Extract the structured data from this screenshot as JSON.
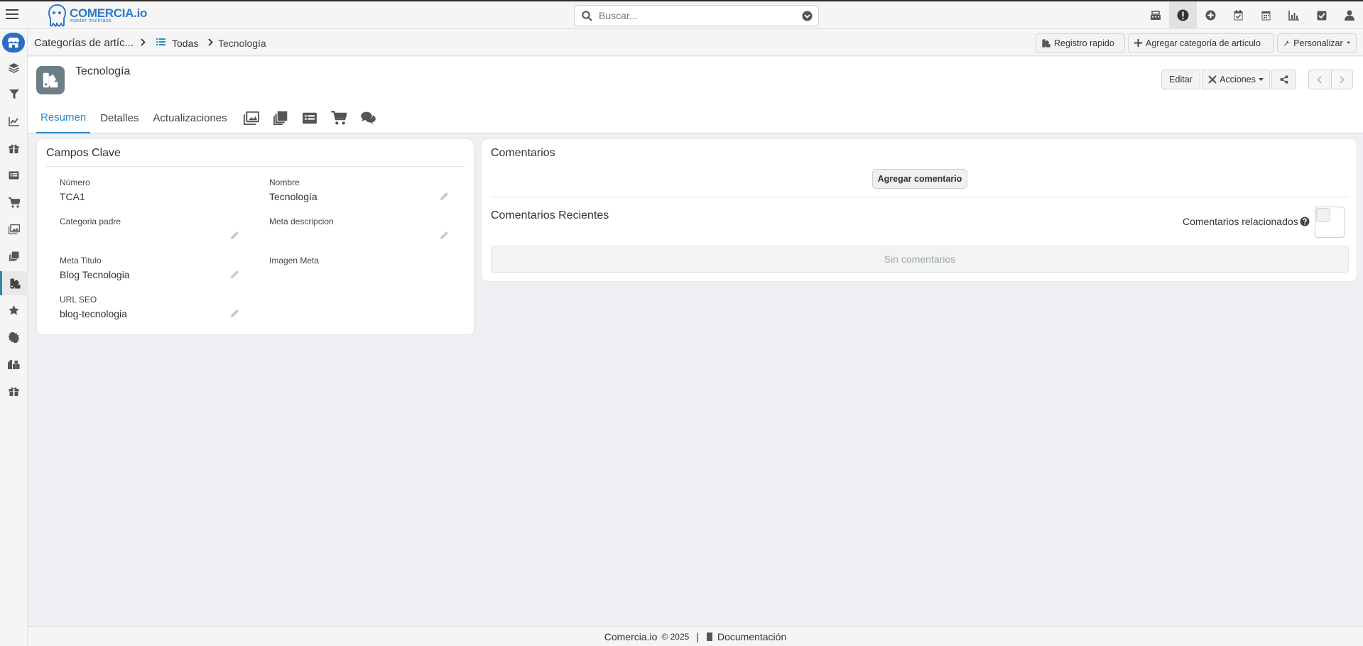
{
  "app": {
    "logo_name": "COMERCIA.io",
    "logo_tagline": "master multitask"
  },
  "search": {
    "placeholder": "Buscar..."
  },
  "top_icons": [
    "cash-register-icon",
    "alert-icon",
    "plus-circle-icon",
    "calendar-check-icon",
    "calendar-icon",
    "bar-chart-icon",
    "check-square-icon",
    "user-icon"
  ],
  "breadcrumb": {
    "module": "Categorías de artíc...",
    "list": "Todas",
    "current": "Tecnología"
  },
  "crumb_buttons": {
    "quick": "Registro rapido",
    "add": "Agregar categoría de artículo",
    "customize": "Personalizar"
  },
  "record": {
    "title": "Tecnología",
    "edit_label": "Editar",
    "actions_label": "Acciones"
  },
  "tabs": [
    "Resumen",
    "Detalles",
    "Actualizaciones"
  ],
  "tab_icons": [
    "images-icon",
    "copy-icon",
    "list-icon",
    "cart-icon",
    "comments-icon"
  ],
  "key_fields": {
    "title": "Campos Clave",
    "fields": [
      {
        "label": "Número",
        "value": "TCA1"
      },
      {
        "label": "Nombre",
        "value": "Tecnología"
      },
      {
        "label": "Categoria padre",
        "value": ""
      },
      {
        "label": "Meta descripcion",
        "value": ""
      },
      {
        "label": "Meta Titulo",
        "value": "Blog Tecnologia"
      },
      {
        "label": "Imagen Meta",
        "value": ""
      },
      {
        "label": "URL SEO",
        "value": "blog-tecnologia"
      }
    ]
  },
  "comments": {
    "title": "Comentarios",
    "add_label": "Agregar comentario",
    "recent_title": "Comentarios Recientes",
    "related_label": "Comentarios relacionados",
    "related_enabled": false,
    "empty_text": "Sin comentarios"
  },
  "footer": {
    "brand": "Comercia.io",
    "copyright": "© 2025",
    "separator": "|",
    "docs": "Documentación"
  }
}
